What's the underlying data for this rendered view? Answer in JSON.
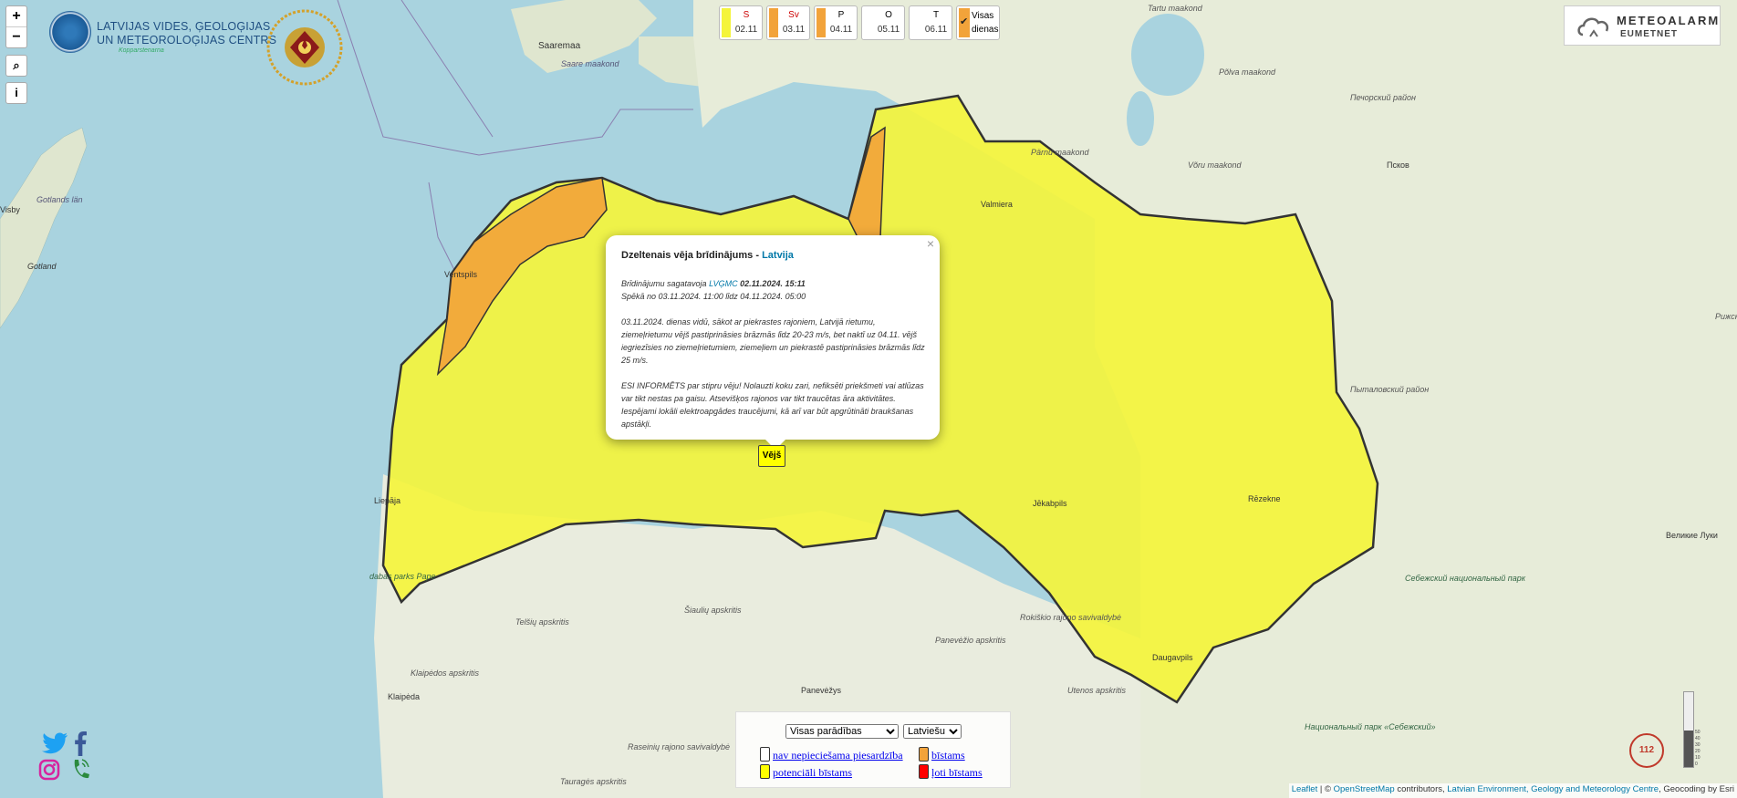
{
  "map": {
    "sea_labels": [
      "Saaremaa",
      "Saare maakond",
      "Gotlands län",
      "Gotland",
      "Visby"
    ],
    "place_labels": [
      "Tartu maakond",
      "Põlva maakond",
      "Võru maakond",
      "Pärnu maakond",
      "Псков",
      "Valmiera",
      "Ventspils",
      "Liepāja",
      "Jēkabpils",
      "Rēzekne",
      "Daugavpils",
      "Klaipėda",
      "Panevėžys",
      "Великие Луки",
      "Tauragės apskritis",
      "Šiaulių apskritis",
      "Telšių apskritis",
      "Klaipėdos apskritis",
      "Panevėžio apskritis",
      "Utenos apskritis",
      "Raseinių rajono savivaldybė",
      "Rokiškio rajono savivaldybė",
      "dabas parks Pape",
      "Себежский национальный парк",
      "Национальный парк «Себежский»",
      "Пыталовский район",
      "Печорский район",
      "Рижская область"
    ],
    "colors": {
      "sea": "#a9d3df",
      "land": "#e7ecd9",
      "yellow": "#f4f43c",
      "orange": "#f2a33a",
      "border": "#333333"
    }
  },
  "zoom": {
    "in": "+",
    "out": "−"
  },
  "controls": {
    "search_icon": "⌕",
    "info_icon": "i"
  },
  "lvgmc": {
    "line1": "LATVIJAS VIDES, ĢEOLOĢIJAS",
    "line2": "UN METEOROLOĢIJAS CENTRS",
    "line3": "Kopparstenarna"
  },
  "days": [
    {
      "label": "S",
      "date": "02.11",
      "color": "#f4f43c",
      "red": true
    },
    {
      "label": "Sv",
      "date": "03.11",
      "color": "#f2a33a",
      "red": true
    },
    {
      "label": "P",
      "date": "04.11",
      "color": "#f2a33a",
      "red": false
    },
    {
      "label": "O",
      "date": "05.11",
      "color": "#ffffff",
      "red": false
    },
    {
      "label": "T",
      "date": "06.11",
      "color": "#ffffff",
      "red": false
    }
  ],
  "all_days": {
    "check": "✔",
    "line1": "Visas",
    "line2": "dienas"
  },
  "meteoalarm": {
    "title": "METEOALARM",
    "sub": "EUMETNET"
  },
  "popup": {
    "close": "×",
    "title": "Dzeltenais vēja brīdinājums - ",
    "title_link": "Latvija",
    "prepared_prefix": "Brīdinājumu sagatavoja ",
    "prepared_link": "LVĢMC",
    "prepared_time": " 02.11.2024. 15:11",
    "valid": "Spēkā no 03.11.2024. 11:00 līdz 04.11.2024. 05:00",
    "description": "03.11.2024. dienas vidū, sākot ar piekrastes rajoniem, Latvijā rietumu, ziemeļrietumu vējš pastiprināsies brāzmās līdz 20-23 m/s, bet naktī uz 04.11. vējš iegriezīsies no ziemeļrietumiem, ziemeļiem un piekrastē pastiprināsies brāzmās līdz 25 m/s.",
    "advice": "ESI INFORMĒTS par stipru vēju! Nolauzti koku zari, nefiksēti priekšmeti vai atlūzas var tikt nestas pa gaisu. Atsevišķos rajonos var tikt traucētas āra aktivitātes. Iespējami lokāli elektroapgādes traucējumi, kā arī var būt apgrūtināti braukšanas apstākļi."
  },
  "marker": {
    "label": "Vējš"
  },
  "legend": {
    "events_select": "Visas parādības",
    "lang_select": "Latviešu",
    "items": [
      {
        "label": "nav nepieciešama piesardzība",
        "color": "#ffffff"
      },
      {
        "label": "bīstams",
        "color": "#f2a33a"
      },
      {
        "label": "potenciāli bīstams",
        "color": "#ffff00"
      },
      {
        "label": "ļoti bīstams",
        "color": "#ff0000"
      }
    ]
  },
  "emergency": {
    "label": "112"
  },
  "scale_labels": [
    "50",
    "40",
    "30",
    "20",
    "10",
    "0"
  ],
  "attribution": {
    "leaflet": "Leaflet",
    "sep1": " | © ",
    "osm": "OpenStreetMap",
    "contrib": " contributors, ",
    "lvgmc": "Latvian Environment, Geology and Meteorology Centre",
    "geocode": ", Geocoding by Esri"
  }
}
